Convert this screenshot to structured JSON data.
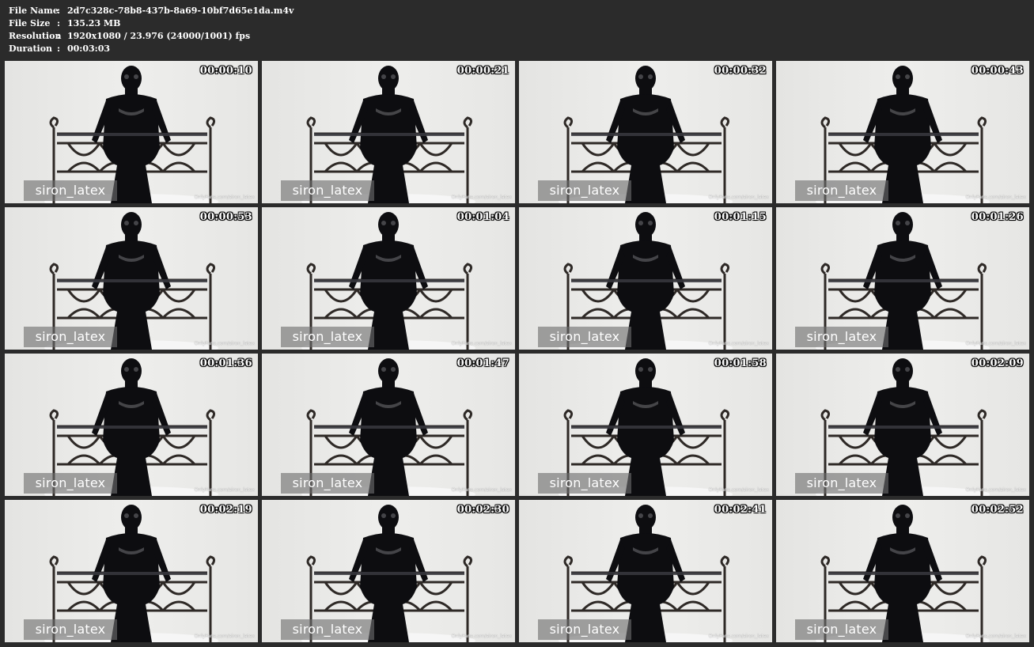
{
  "header": {
    "rows": [
      {
        "label": "File Name",
        "sep": ":",
        "value": "2d7c328c-78b8-437b-8a69-10bf7d65e1da.m4v"
      },
      {
        "label": "File Size",
        "sep": ":",
        "value": "135.23 MB"
      },
      {
        "label": "Resolution",
        "sep": ":",
        "value": "1920x1080 / 23.976 (24000/1001) fps"
      },
      {
        "label": "Duration",
        "sep": ":",
        "value": "00:03:03"
      }
    ]
  },
  "thumbnails": [
    {
      "timecode": "00:00:10",
      "watermark": "siron_latex",
      "credit": "OnlyFans.com/siron_latex"
    },
    {
      "timecode": "00:00:21",
      "watermark": "siron_latex",
      "credit": "OnlyFans.com/siron_latex"
    },
    {
      "timecode": "00:00:32",
      "watermark": "siron_latex",
      "credit": "OnlyFans.com/siron_latex"
    },
    {
      "timecode": "00:00:43",
      "watermark": "siron_latex",
      "credit": "OnlyFans.com/siron_latex"
    },
    {
      "timecode": "00:00:53",
      "watermark": "siron_latex",
      "credit": "OnlyFans.com/siron_latex"
    },
    {
      "timecode": "00:01:04",
      "watermark": "siron_latex",
      "credit": "OnlyFans.com/siron_latex"
    },
    {
      "timecode": "00:01:15",
      "watermark": "siron_latex",
      "credit": "OnlyFans.com/siron_latex"
    },
    {
      "timecode": "00:01:26",
      "watermark": "siron_latex",
      "credit": "OnlyFans.com/siron_latex"
    },
    {
      "timecode": "00:01:36",
      "watermark": "siron_latex",
      "credit": "OnlyFans.com/siron_latex"
    },
    {
      "timecode": "00:01:47",
      "watermark": "siron_latex",
      "credit": "OnlyFans.com/siron_latex"
    },
    {
      "timecode": "00:01:58",
      "watermark": "siron_latex",
      "credit": "OnlyFans.com/siron_latex"
    },
    {
      "timecode": "00:02:09",
      "watermark": "siron_latex",
      "credit": "OnlyFans.com/siron_latex"
    },
    {
      "timecode": "00:02:19",
      "watermark": "siron_latex",
      "credit": "OnlyFans.com/siron_latex"
    },
    {
      "timecode": "00:02:30",
      "watermark": "siron_latex",
      "credit": "OnlyFans.com/siron_latex"
    },
    {
      "timecode": "00:02:41",
      "watermark": "siron_latex",
      "credit": "OnlyFans.com/siron_latex"
    },
    {
      "timecode": "00:02:52",
      "watermark": "siron_latex",
      "credit": "OnlyFans.com/siron_latex"
    }
  ],
  "colors": {
    "page_background": "#2b2b2b",
    "header_text": "#ffffff",
    "frame_wall": "#eeeeec",
    "bed_frame": "#2e2926",
    "figure": "#0d0d10"
  }
}
